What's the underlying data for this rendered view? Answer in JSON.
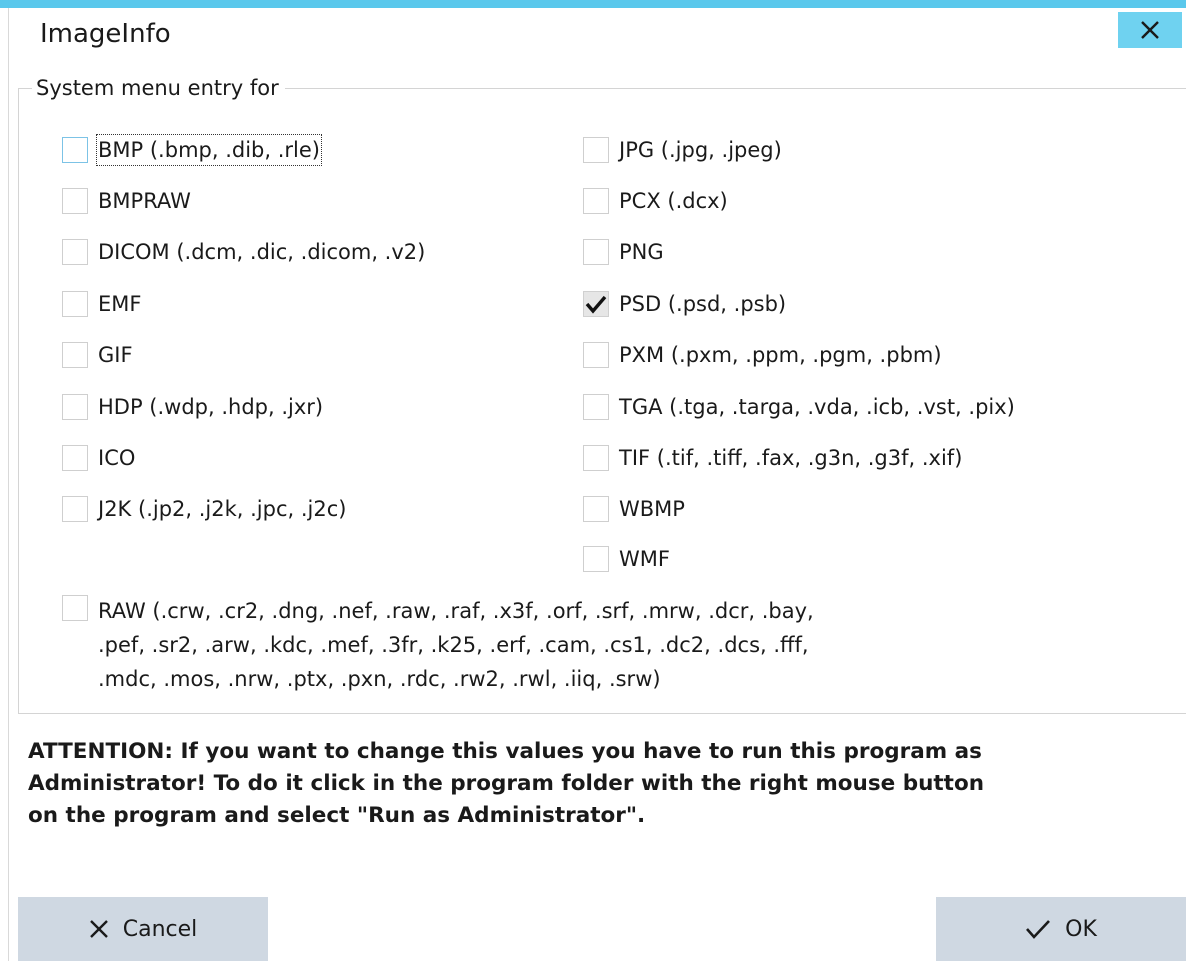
{
  "window": {
    "title": "ImageInfo",
    "close_icon": "close-icon"
  },
  "group": {
    "legend": "System menu entry for"
  },
  "left_options": [
    {
      "label": "BMP (.bmp, .dib, .rle)",
      "checked": false
    },
    {
      "label": "BMPRAW",
      "checked": false
    },
    {
      "label": "DICOM (.dcm, .dic, .dicom, .v2)",
      "checked": false
    },
    {
      "label": "EMF",
      "checked": false
    },
    {
      "label": "GIF",
      "checked": false
    },
    {
      "label": "HDP (.wdp, .hdp, .jxr)",
      "checked": false
    },
    {
      "label": "ICO",
      "checked": false
    },
    {
      "label": "J2K (.jp2, .j2k, .jpc, .j2c)",
      "checked": false
    }
  ],
  "right_options": [
    {
      "label": "JPG (.jpg, .jpeg)",
      "checked": false
    },
    {
      "label": "PCX (.dcx)",
      "checked": false
    },
    {
      "label": "PNG",
      "checked": false
    },
    {
      "label": "PSD (.psd, .psb)",
      "checked": true
    },
    {
      "label": "PXM (.pxm, .ppm, .pgm, .pbm)",
      "checked": false
    },
    {
      "label": "TGA (.tga, .targa, .vda, .icb, .vst, .pix)",
      "checked": false
    },
    {
      "label": "TIF (.tif, .tiff, .fax, .g3n, .g3f, .xif)",
      "checked": false
    },
    {
      "label": "WBMP",
      "checked": false
    },
    {
      "label": "WMF",
      "checked": false
    }
  ],
  "raw_option": {
    "checked": false,
    "lines": [
      "RAW (.crw, .cr2, .dng, .nef, .raw, .raf, .x3f, .orf, .srf, .mrw, .dcr, .bay,",
      ".pef, .sr2, .arw, .kdc, .mef, .3fr, .k25, .erf, .cam, .cs1, .dc2, .dcs, .fff,",
      ".mdc, .mos, .nrw, .ptx, .pxn, .rdc, .rw2, .rwl, .iiq, .srw)"
    ]
  },
  "attention": {
    "lines": [
      "ATTENTION: If you want to change this values you have to run this program as",
      "Administrator! To do it click in the program folder with the right mouse button",
      "on the program and select \"Run as Administrator\"."
    ]
  },
  "buttons": {
    "cancel_label": "Cancel",
    "cancel_icon": "close-icon",
    "ok_label": "OK",
    "ok_icon": "checkmark-icon"
  },
  "colors": {
    "accent": "#5ac8ec",
    "close_button": "#6fd2f0",
    "button_bg": "#cfd8e2"
  }
}
